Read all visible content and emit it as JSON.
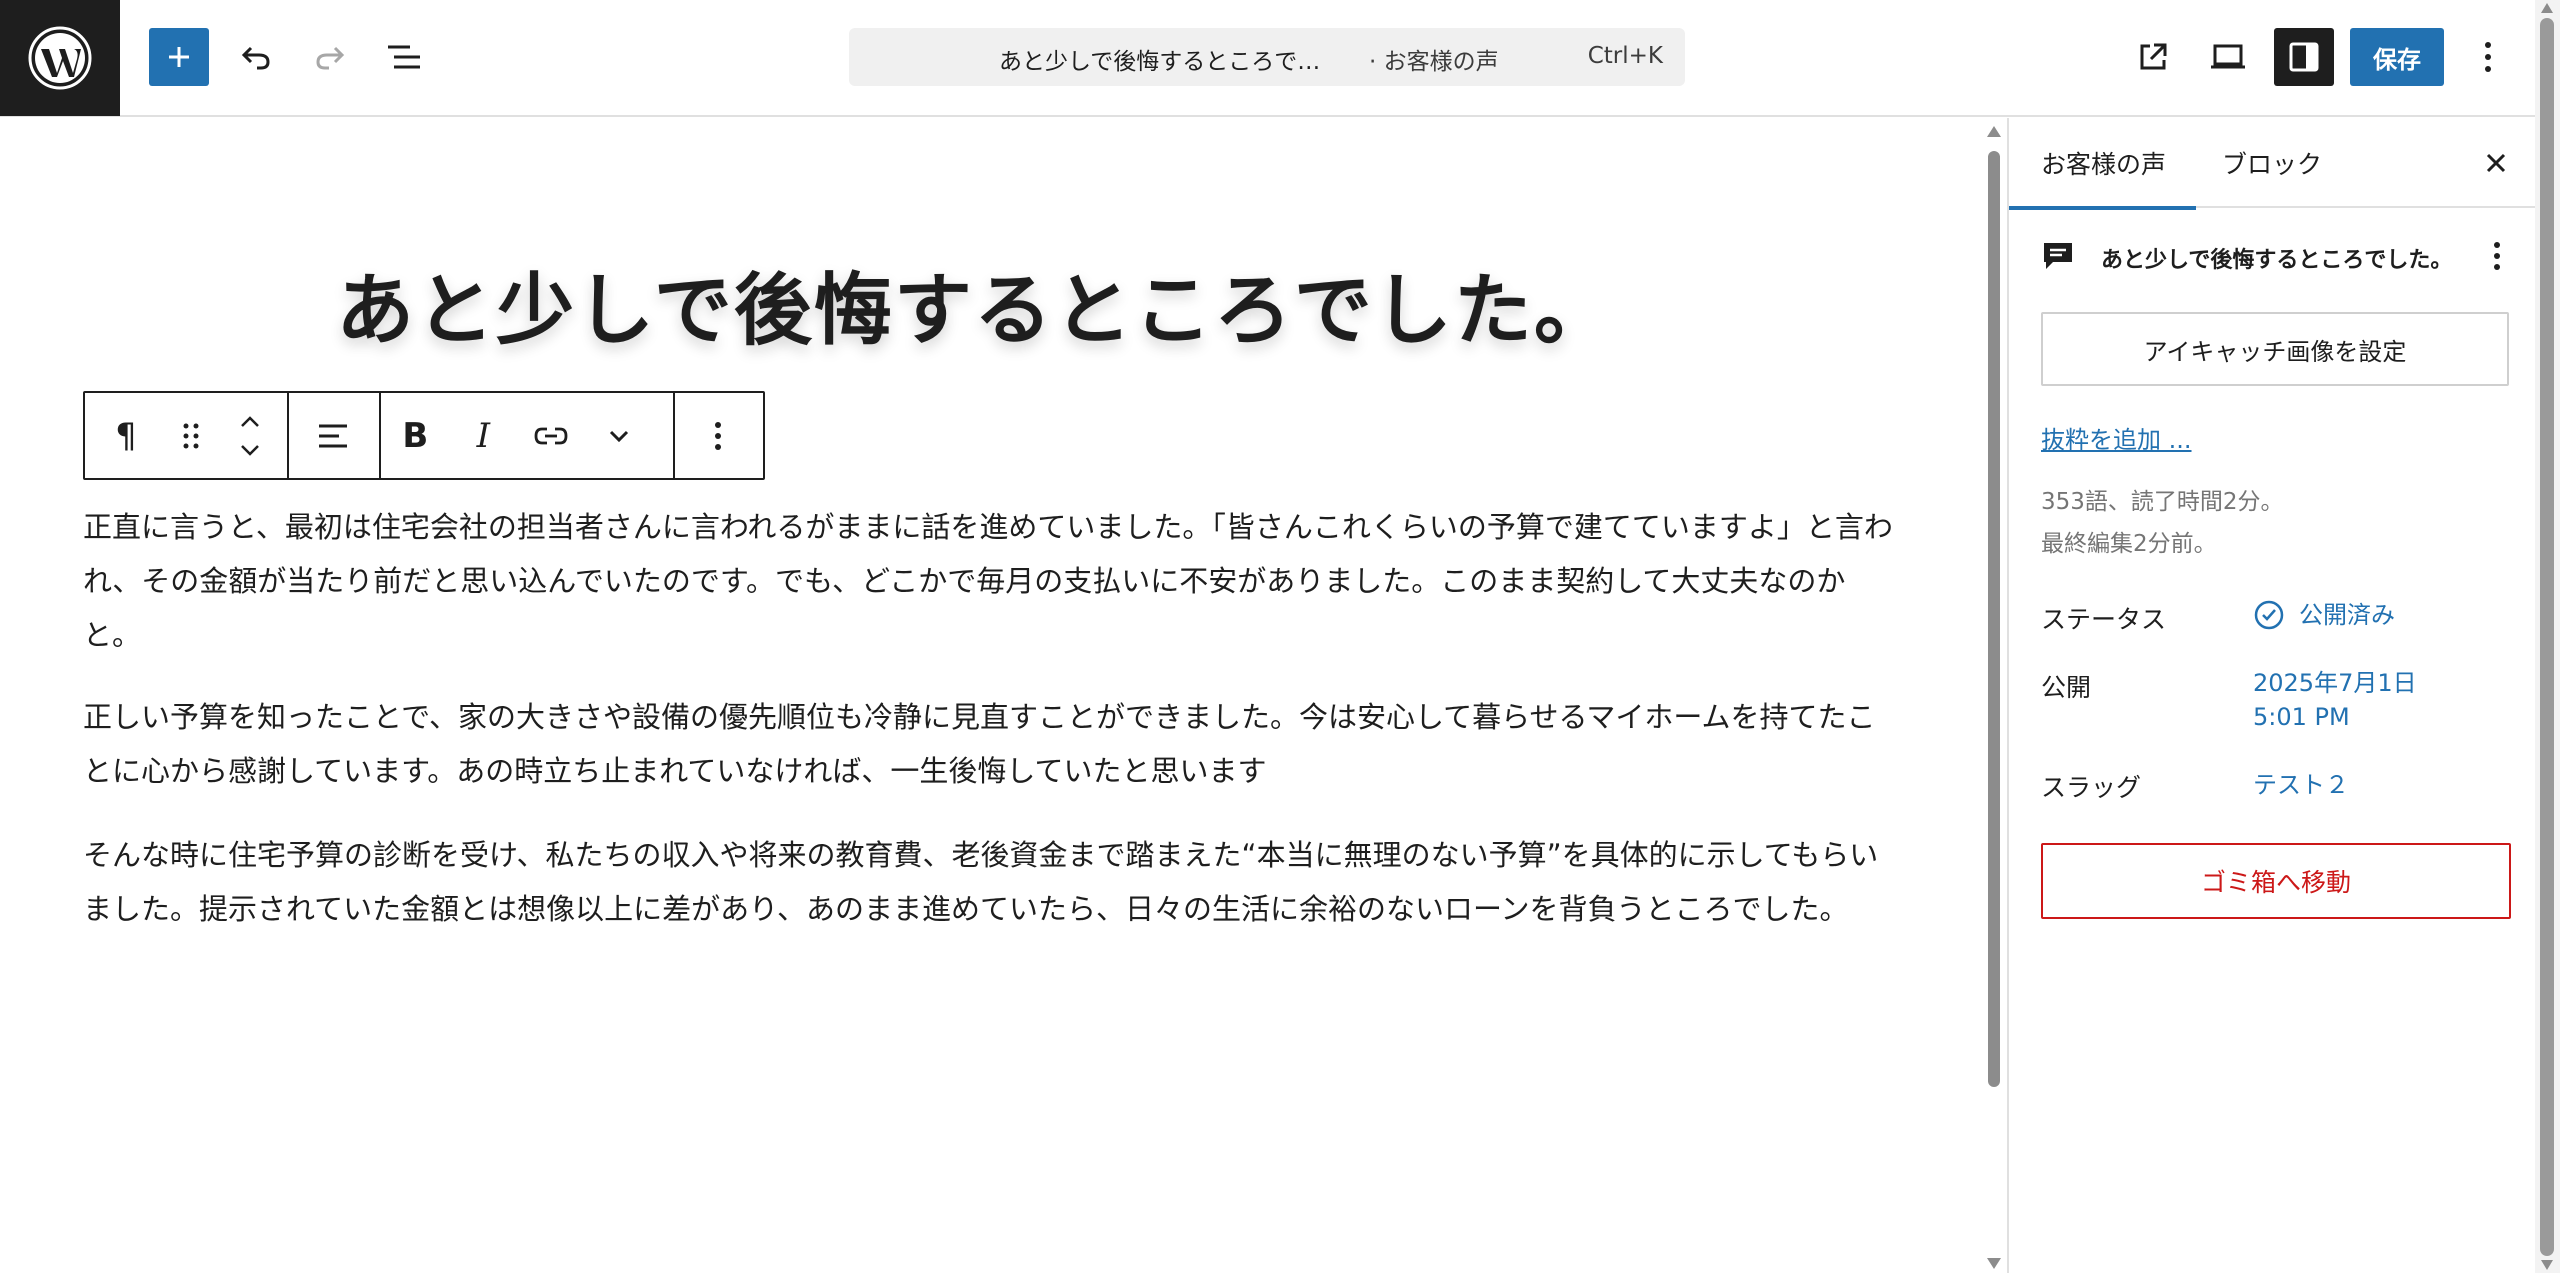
{
  "header": {
    "logo": "wordpress-logo",
    "add_block_label": "+",
    "command_bar": {
      "title": "あと少しで後悔するところで…",
      "post_type": "· お客様の声",
      "shortcut": "Ctrl+K"
    },
    "save_label": "保存"
  },
  "editor": {
    "title": "あと少しで後悔するところでした。",
    "toolbar": {
      "paragraph_icon": "¶",
      "bold_label": "B",
      "italic_label": "I"
    },
    "paragraphs": [
      "正直に言うと、最初は住宅会社の担当者さんに言われるがままに話を進めていました。「皆さんこれくらいの予算で建てていますよ」と言われ、その金額が当たり前だと思い込んでいたのです。でも、どこかで毎月の支払いに不安がありました。このまま契約して大丈夫なのかと。",
      "正しい予算を知ったことで、家の大きさや設備の優先順位も冷静に見直すことができました。今は安心して暮らせるマイホームを持てたことに心から感謝しています。あの時立ち止まれていなければ、一生後悔していたと思います",
      "そんな時に住宅予算の診断を受け、私たちの収入や将来の教育費、老後資金まで踏まえた“本当に無理のない予算”を具体的に示してもらいました。提示されていた金額とは想像以上に差があり、あのまま進めていたら、日々の生活に余裕のないローンを背負うところでした。"
    ]
  },
  "sidebar": {
    "tabs": [
      {
        "label": "お客様の声",
        "active": true
      },
      {
        "label": "ブロック",
        "active": false
      }
    ],
    "post_card_title": "あと少しで後悔するところでした。",
    "featured_image_label": "アイキャッチ画像を設定",
    "excerpt_link": "抜粋を追加 ...",
    "word_count": "353語、読了時間2分。",
    "last_edited": "最終編集2分前。",
    "status": {
      "label": "ステータス",
      "value": "公開済み"
    },
    "publish": {
      "label": "公開",
      "date": "2025年7月1日",
      "time": "5:01 PM"
    },
    "slug": {
      "label": "スラッグ",
      "value": "テスト２"
    },
    "trash_label": "ゴミ箱へ移動"
  },
  "colors": {
    "accent": "#2271b1",
    "dark": "#1e1e1e",
    "danger": "#cc1818",
    "muted": "#757575"
  }
}
